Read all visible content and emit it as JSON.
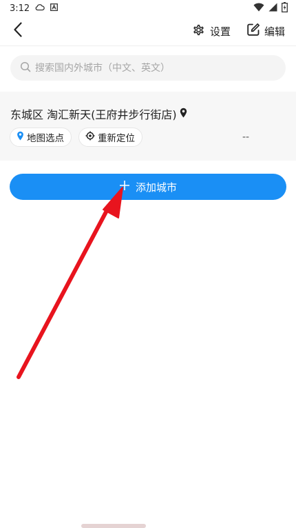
{
  "status_bar": {
    "time": "3:12",
    "left_icons": [
      "cloud-icon",
      "a-notification-icon"
    ],
    "right_icons": [
      "wifi-icon",
      "signal-icon",
      "battery-charging-icon"
    ]
  },
  "top_bar": {
    "back_icon": "chevron-left-icon",
    "settings_label": "设置",
    "settings_icon": "gear-icon",
    "edit_label": "编辑",
    "edit_icon": "edit-icon"
  },
  "search": {
    "placeholder": "搜索国内外城市（中文、英文）",
    "value": ""
  },
  "current_location": {
    "title": "东城区 淘汇新天(王府井步行街店)",
    "pin_icon": "location-pin-icon",
    "map_pick_label": "地图选点",
    "relocate_label": "重新定位",
    "temperature": "--"
  },
  "add_city": {
    "label": "添加城市",
    "icon": "plus-icon"
  },
  "colors": {
    "accent": "#1a8ff5",
    "annotation_arrow": "#e8141e"
  }
}
